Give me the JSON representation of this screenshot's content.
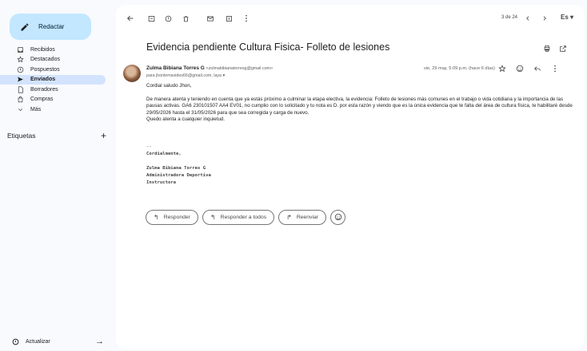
{
  "sidebar": {
    "compose_label": "Redactar",
    "items": [
      {
        "label": "Recibidos",
        "icon": "inbox-icon"
      },
      {
        "label": "Destacados",
        "icon": "star-icon"
      },
      {
        "label": "Pospuestos",
        "icon": "clock-icon"
      },
      {
        "label": "Enviados",
        "icon": "send-icon",
        "active": true
      },
      {
        "label": "Borradores",
        "icon": "draft-icon"
      },
      {
        "label": "Compras",
        "icon": "shopping-bag-icon"
      },
      {
        "label": "Más",
        "icon": "chevron-down-icon"
      }
    ],
    "labels_title": "Etiquetas",
    "labels_add": "+",
    "refresh_label": "Actualizar"
  },
  "toolbar": {
    "pager": "3 de 24",
    "input_tool": "Es"
  },
  "email": {
    "subject": "Evidencia pendiente Cultura Fisica- Folleto de lesiones",
    "sender_name": "Zulma Bibiana Torres G",
    "sender_email": "<zulmabibianatorresg@gmail.com>",
    "recipients": "para jhonlemavides66@gmail.com, laya",
    "date": "vie, 29 may, 5:09 p.m. (hace 6 días)",
    "greeting": "Cordial saludo Jhon,",
    "body": "De manera atenta y teniendo en cuenta que ya estás próximo a culminar la etapa electiva, la evidencia: Folleto de lesiones más comunes en el trabajo o vida cotidiana y la importancia de las pausas activas. GA6 230101507 AA4 EV01, no cumplio con lo solicitado y tu nota es D. por esta razón y viendo que es la única evidencia que te falta del área de cultura física, te habilitaré desde 29/05/2026 hasta el 31/05/2026 para que sea corregida y carga de nuevo.",
    "closing_line": "Quedo atenta a cualquier inquietud.",
    "sig_dots": "--",
    "sig_cordially": "Cordialmente,",
    "sig_name": "Zulma Bibiana Torres G",
    "sig_role": "Administradora Deportiva",
    "sig_title": "Instructora"
  },
  "actions": {
    "reply": "Responder",
    "reply_all": "Responder a todos",
    "forward": "Reenviar"
  },
  "colors": {
    "compose_bg": "#c2e7ff",
    "active_nav": "#d3e3fd",
    "page_bg": "#f8fafd"
  }
}
